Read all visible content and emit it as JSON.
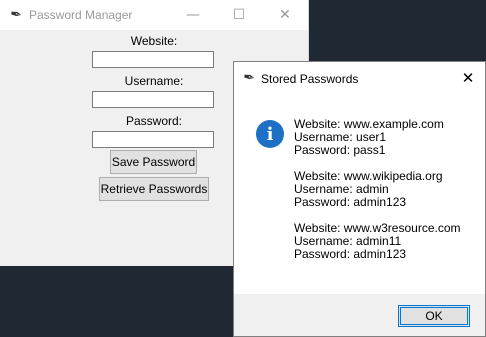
{
  "main_window": {
    "title": "Password Manager",
    "controls": {
      "minimize": "—",
      "maximize": "☐",
      "close": "✕"
    },
    "labels": {
      "website": "Website:",
      "username": "Username:",
      "password": "Password:"
    },
    "fields": {
      "website": "",
      "username": "",
      "password": ""
    },
    "buttons": {
      "save": "Save Password",
      "retrieve": "Retrieve Passwords"
    }
  },
  "dialog": {
    "title": "Stored Passwords",
    "close": "✕",
    "icon": "info-icon",
    "icon_glyph": "i",
    "message": "Website: www.example.com\nUsername: user1\nPassword: pass1\n\nWebsite: www.wikipedia.org\nUsername: admin\nPassword: admin123\n\nWebsite: www.w3resource.com\nUsername: admin11\nPassword: admin123",
    "ok_label": "OK"
  },
  "colors": {
    "desktop": "#1f2833",
    "info_blue": "#1e6fc6",
    "focus_border": "#0078d7"
  }
}
